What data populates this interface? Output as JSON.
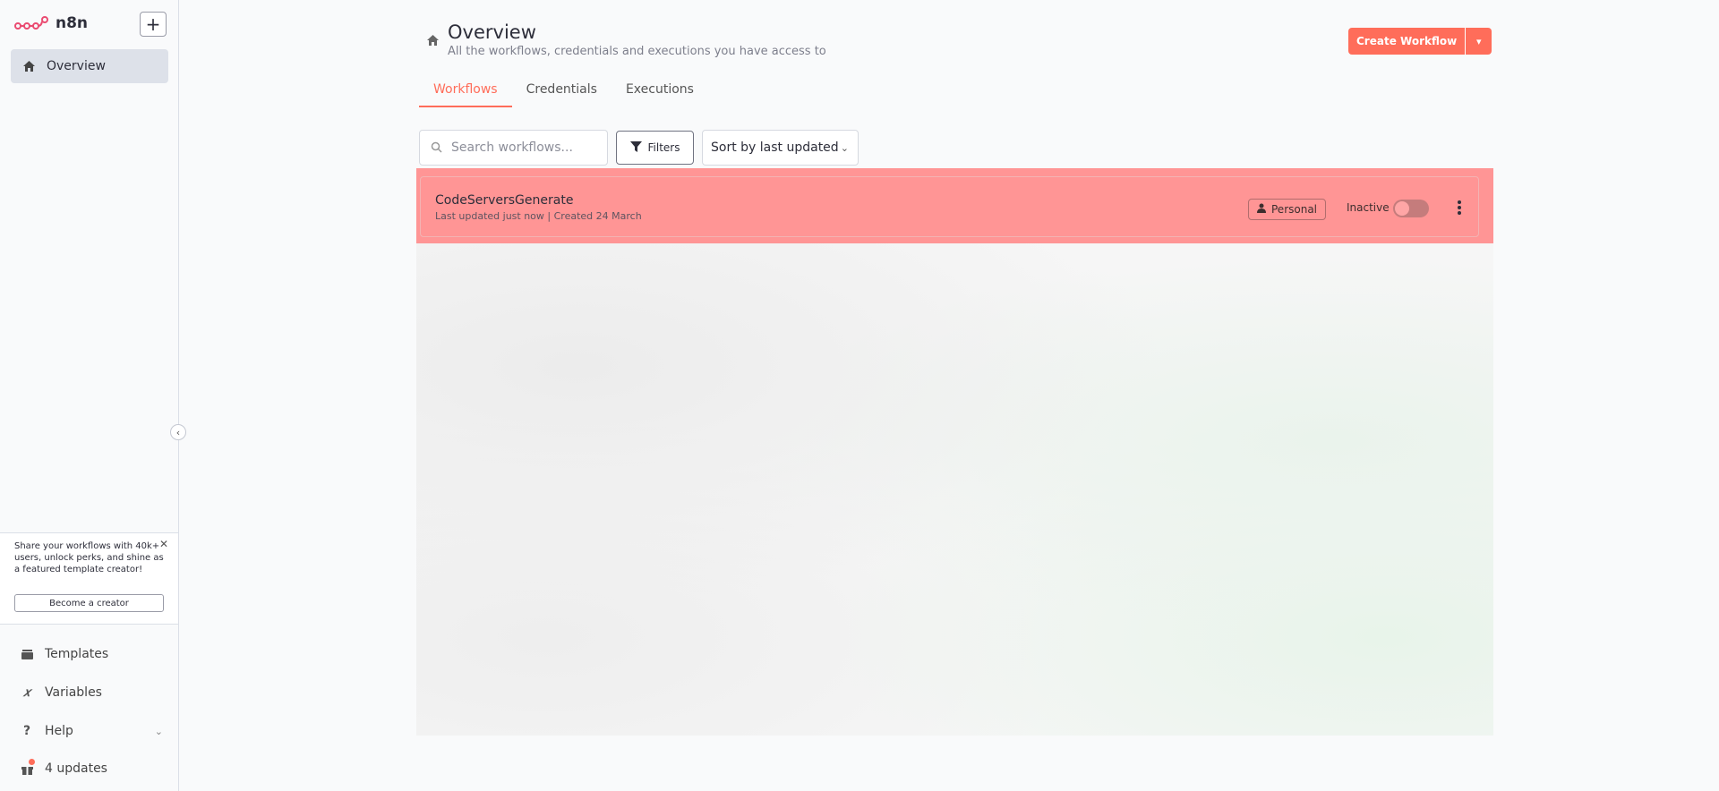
{
  "app": {
    "name": "n8n",
    "brand_color": "#ff6d5a"
  },
  "sidebar": {
    "add_icon": "plus-icon",
    "items": [
      {
        "label": "Overview",
        "icon": "home-icon",
        "active": true
      }
    ],
    "creator_card": {
      "text": "Share your workflows with 40k+ users, unlock perks, and shine as a featured template creator!",
      "button_label": "Become a creator"
    },
    "bottom_items": [
      {
        "label": "Templates",
        "icon": "box-icon"
      },
      {
        "label": "Variables",
        "icon": "variable-icon"
      },
      {
        "label": "Help",
        "icon": "help-icon"
      },
      {
        "label": "4 updates",
        "icon": "gift-icon"
      }
    ]
  },
  "header": {
    "title": "Overview",
    "subtitle": "All the workflows, credentials and executions you have access to",
    "create_button": "Create Workflow"
  },
  "tabs": [
    {
      "label": "Workflows",
      "active": true
    },
    {
      "label": "Credentials",
      "active": false
    },
    {
      "label": "Executions",
      "active": false
    }
  ],
  "toolbar": {
    "search_placeholder": "Search workflows...",
    "filters_label": "Filters",
    "sort_label": "Sort by last updated"
  },
  "workflows": [
    {
      "name": "CodeServersGenerate",
      "meta": "Last updated just now | Created 24 March",
      "owner": "Personal",
      "status": "Inactive"
    }
  ]
}
